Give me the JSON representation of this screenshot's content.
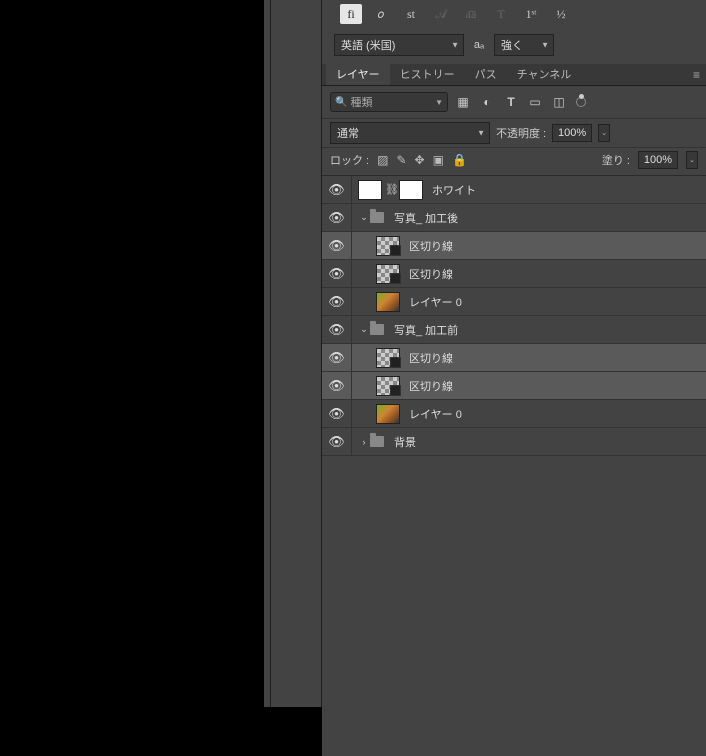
{
  "opentype": {
    "buttons": [
      "fi",
      "𝑜",
      "st",
      "𝒜",
      "a͞a",
      "T",
      "1ˢᵗ",
      "½"
    ]
  },
  "language": {
    "value": "英語 (米国)",
    "aa": "aₐ",
    "str": "強く"
  },
  "tabs": {
    "items": [
      "レイヤー",
      "ヒストリー",
      "パス",
      "チャンネル"
    ],
    "active": 0
  },
  "filter": {
    "search": "種類",
    "icons": [
      "image",
      "adjust",
      "text",
      "shape",
      "smart"
    ]
  },
  "blend": {
    "mode": "通常",
    "opacity_label": "不透明度 :",
    "opacity": "100%"
  },
  "lock": {
    "label": "ロック :",
    "fill_label": "塗り :",
    "fill": "100%"
  },
  "layers": [
    {
      "type": "adj",
      "name": "ホワイト",
      "indent": 0
    },
    {
      "type": "group",
      "name": "写真_ 加工後",
      "indent": 0,
      "open": true
    },
    {
      "type": "mask",
      "name": "区切り線",
      "indent": 1,
      "sel": true
    },
    {
      "type": "mask",
      "name": "区切り線",
      "indent": 1
    },
    {
      "type": "photo",
      "name": "レイヤー 0",
      "indent": 1
    },
    {
      "type": "group",
      "name": "写真_ 加工前",
      "indent": 0,
      "open": true
    },
    {
      "type": "mask",
      "name": "区切り線",
      "indent": 1,
      "sel": true
    },
    {
      "type": "mask",
      "name": "区切り線",
      "indent": 1,
      "sel": true
    },
    {
      "type": "photo",
      "name": "レイヤー 0",
      "indent": 1
    },
    {
      "type": "group",
      "name": "背景",
      "indent": 0,
      "open": false
    }
  ]
}
